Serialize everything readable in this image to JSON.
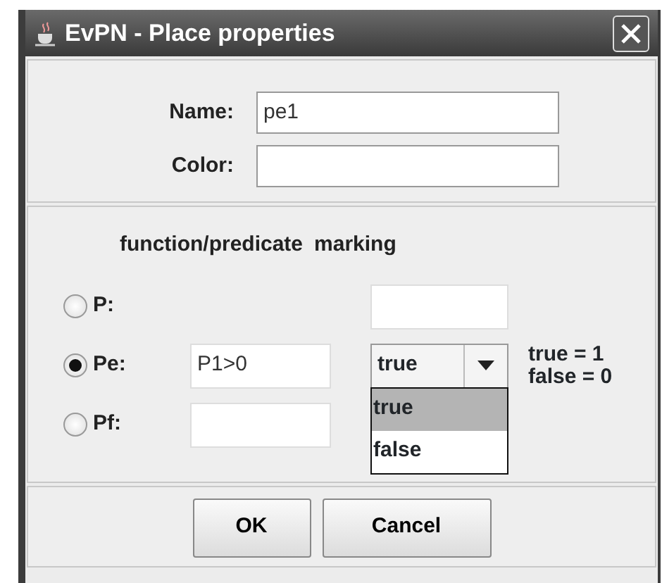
{
  "window": {
    "title": "EvPN - Place properties"
  },
  "name_field": {
    "label": "Name:",
    "value": "pe1"
  },
  "color_field": {
    "label": "Color:"
  },
  "headers": [
    "function/predicate",
    "marking"
  ],
  "rows": [
    {
      "label": "P:",
      "selected": false,
      "function_field": false,
      "marking": {
        "kind": "text"
      }
    },
    {
      "label": "Pe:",
      "selected": true,
      "function_field": true,
      "function_value": "P1>0",
      "marking": {
        "kind": "combo",
        "value": "true",
        "expanded": true,
        "options": [
          {
            "label": "true",
            "selected": true
          },
          {
            "label": "false",
            "selected": false
          }
        ]
      },
      "legend": [
        "true = 1",
        "false = 0"
      ]
    },
    {
      "label": "Pf:",
      "selected": false,
      "function_field": true,
      "marking": {
        "kind": "hidden"
      }
    }
  ],
  "buttons": [
    "OK",
    "Cancel"
  ]
}
